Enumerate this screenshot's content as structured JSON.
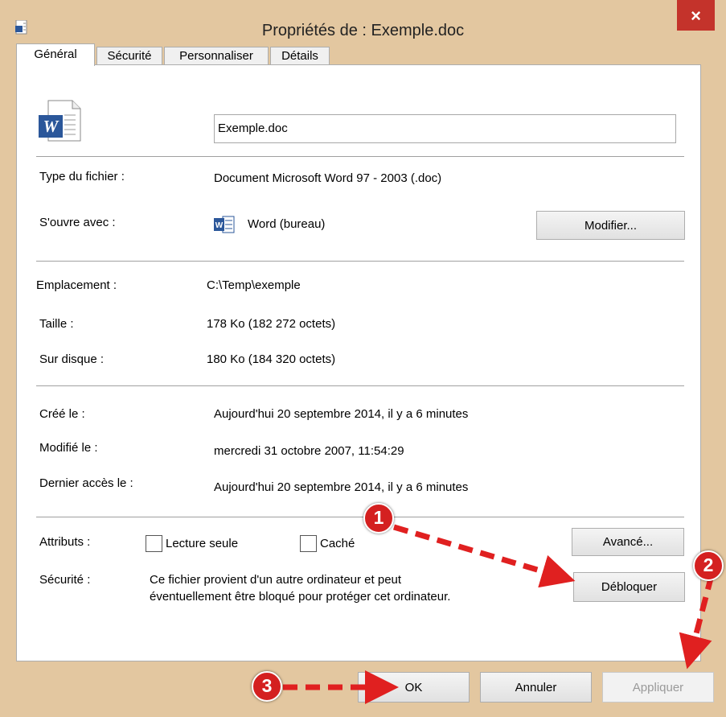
{
  "window": {
    "title": "Propriétés de : Exemple.doc",
    "close_label": "×"
  },
  "tabs": [
    "Général",
    "Sécurité",
    "Personnaliser",
    "Détails"
  ],
  "file": {
    "name": "Exemple.doc"
  },
  "labels": {
    "type": "Type du fichier :",
    "opens_with": "S'ouvre avec :",
    "location": "Emplacement :",
    "size": "Taille :",
    "on_disk": "Sur disque :",
    "created": "Créé le :",
    "modified": "Modifié le :",
    "accessed": "Dernier accès le :",
    "attributes": "Attributs :",
    "security": "Sécurité :"
  },
  "values": {
    "type": "Document Microsoft Word 97 - 2003 (.doc)",
    "opens_with": "Word (bureau)",
    "location": "C:\\Temp\\exemple",
    "size": "178 Ko (182 272 octets)",
    "on_disk": "180 Ko (184 320 octets)",
    "created": "Aujourd'hui 20 septembre 2014, il y a 6 minutes",
    "modified": "mercredi 31 octobre 2007, 11:54:29",
    "accessed": "Aujourd'hui 20 septembre 2014, il y a 6 minutes",
    "security_line1": "Ce fichier provient d'un autre ordinateur et peut",
    "security_line2": "éventuellement être bloqué pour protéger cet ordinateur."
  },
  "checkboxes": {
    "readonly": "Lecture seule",
    "hidden": "Caché"
  },
  "buttons": {
    "modify": "Modifier...",
    "advanced": "Avancé...",
    "unblock": "Débloquer",
    "ok": "OK",
    "cancel": "Annuler",
    "apply": "Appliquer"
  },
  "badges": [
    "1",
    "2",
    "3"
  ],
  "icons": {
    "doc": "word-document-icon",
    "app": "word-app-icon"
  },
  "colors": {
    "frame": "#e3c7a0",
    "close": "#c4332b",
    "badge": "#d42020",
    "arrow": "#e02020",
    "word_blue": "#2b579a"
  }
}
